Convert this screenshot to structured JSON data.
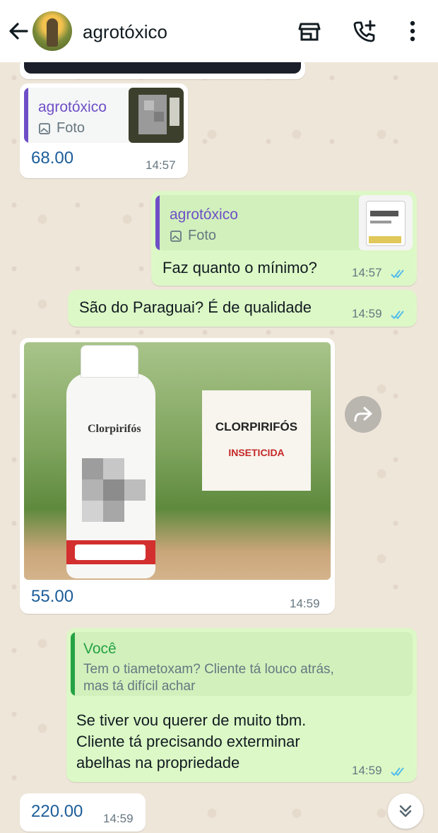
{
  "header": {
    "contact_name": "agrotóxico",
    "back_icon": "arrow-left-icon",
    "icons": [
      "store-icon",
      "add-call-icon",
      "more-vertical-icon"
    ]
  },
  "messages": [
    {
      "id": "m1",
      "direction": "incoming",
      "quote": {
        "author": "agrotóxico",
        "kind": "Foto"
      },
      "text": "68.00",
      "time": "14:57"
    },
    {
      "id": "m2",
      "direction": "outgoing",
      "quote": {
        "author": "agrotóxico",
        "kind": "Foto"
      },
      "text": "Faz quanto o mínimo?",
      "time": "14:57",
      "status": "read"
    },
    {
      "id": "m3",
      "direction": "outgoing",
      "text": "São do Paraguai? É de qualidade",
      "time": "14:59",
      "status": "read"
    },
    {
      "id": "m4",
      "direction": "incoming",
      "image": {
        "bottle_label": "Clorpirifós",
        "sign_title": "CLORPIRIFÓS",
        "sign_subtitle": "INSETICIDA"
      },
      "text": "55.00",
      "time": "14:59"
    },
    {
      "id": "m5",
      "direction": "outgoing",
      "quote": {
        "author": "Você",
        "text_line1": "Tem o tiametoxam? Cliente tá louco atrás,",
        "text_line2": "mas tá difícil achar"
      },
      "text_lines": [
        "Se tiver vou querer de muito tbm.",
        "Cliente tá precisando exterminar",
        "abelhas na propriedade"
      ],
      "time": "14:59",
      "status": "read"
    },
    {
      "id": "m6",
      "direction": "incoming",
      "text": "220.00",
      "time": "14:59"
    }
  ],
  "colors": {
    "incoming_bubble": "#ffffff",
    "outgoing_bubble": "#dcf8c6",
    "quote_author_contact": "#6e4fc7",
    "quote_author_self": "#25a244",
    "read_ticks": "#53bdeb",
    "price_text": "#1c5d99"
  }
}
